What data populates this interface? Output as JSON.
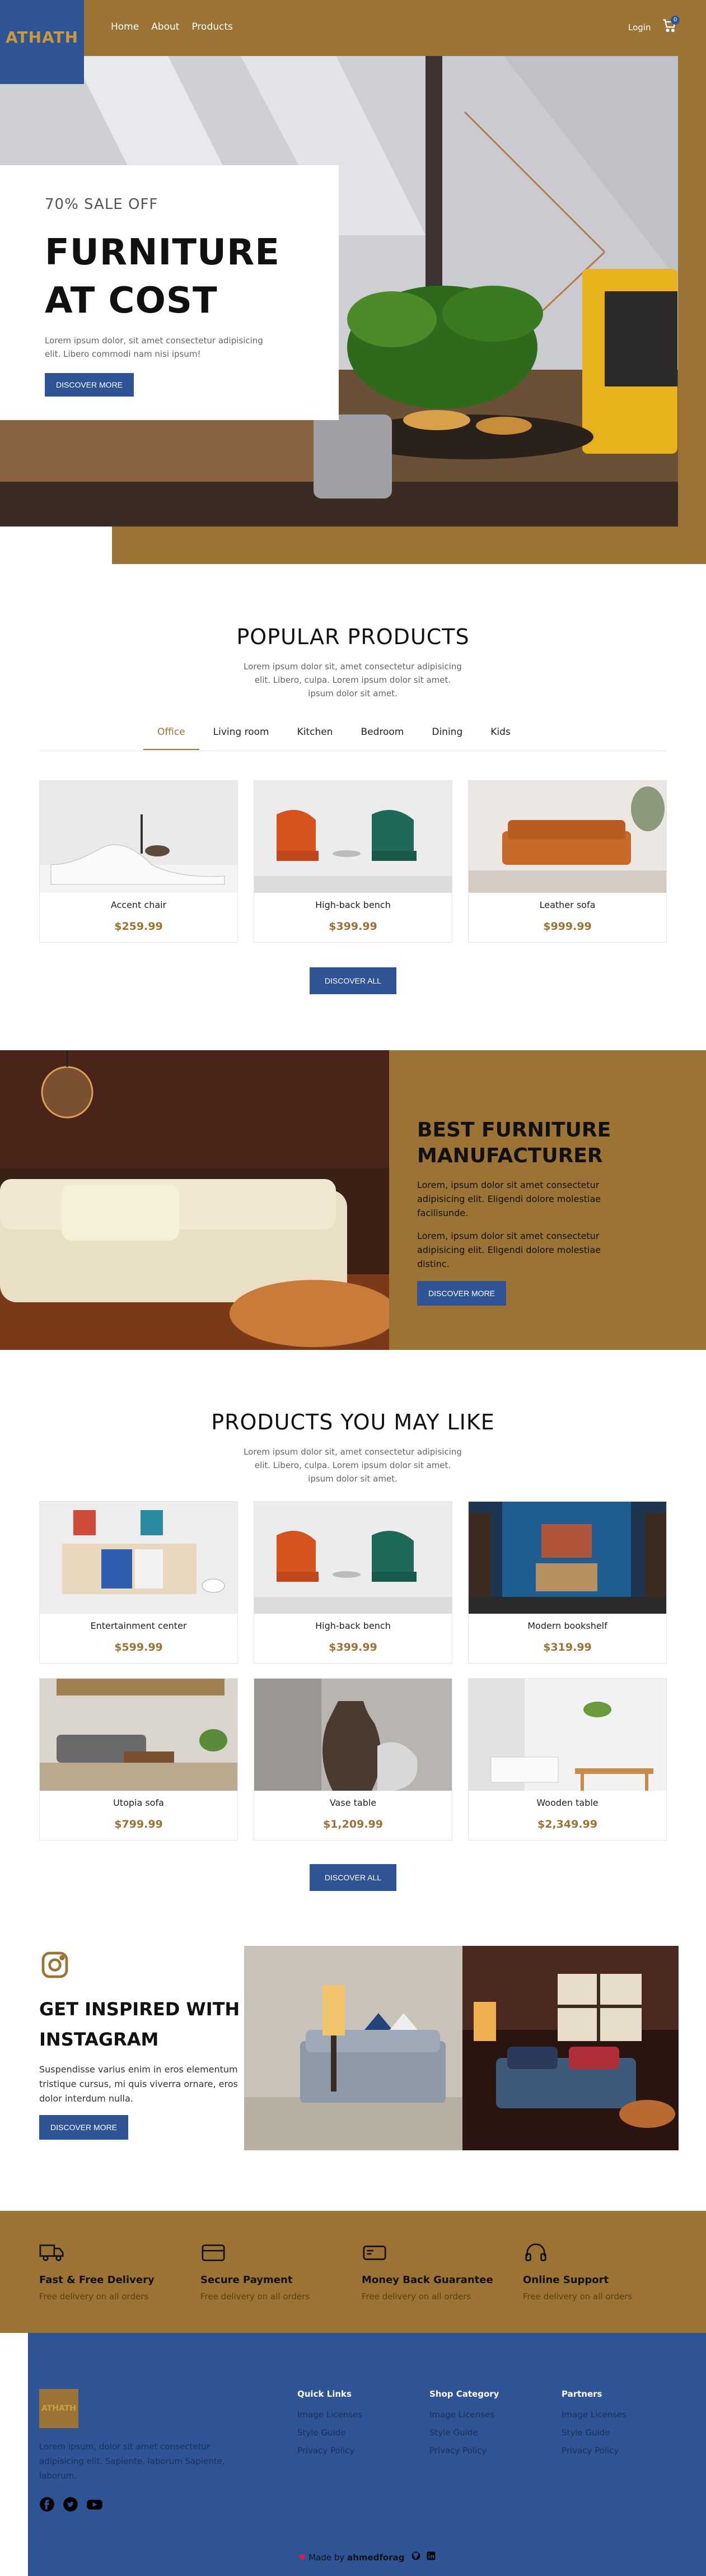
{
  "header": {
    "logo": "ATHATH",
    "nav": [
      "Home",
      "About",
      "Products"
    ],
    "login": "Login",
    "cart_count": "0"
  },
  "hero": {
    "sale": "70% SALE OFF",
    "title_line1": "FURNITURE",
    "title_line2": "AT COST",
    "text": "Lorem ipsum dolor, sit amet consectetur adipisicing elit. Libero commodi nam nisi ipsum!",
    "button": "DISCOVER MORE"
  },
  "popular": {
    "title": "POPULAR PRODUCTS",
    "subtitle": "Lorem ipsum dolor sit, amet consectetur adipisicing elit. Libero, culpa. Lorem ipsum dolor sit amet. ipsum dolor sit amet.",
    "tabs": [
      "Office",
      "Living room",
      "Kitchen",
      "Bedroom",
      "Dining",
      "Kids"
    ],
    "products": [
      {
        "name": "Accent chair",
        "price": "$259.99"
      },
      {
        "name": "High-back bench",
        "price": "$399.99"
      },
      {
        "name": "Leather sofa",
        "price": "$999.99"
      }
    ],
    "button": "DISCOVER ALL"
  },
  "manufacturer": {
    "title_line1": "BEST FURNITURE",
    "title_line2": "MANUFACTURER",
    "p1": "Lorem, ipsum dolor sit amet consectetur adipisicing elit. Eligendi dolore molestiae facilisunde.",
    "p2": "Lorem, ipsum dolor sit amet consectetur adipisicing elit. Eligendi dolore molestiae distinc.",
    "button": "DISCOVER MORE"
  },
  "like": {
    "title": "PRODUCTS YOU MAY LIKE",
    "subtitle": "Lorem ipsum dolor sit, amet consectetur adipisicing elit. Libero, culpa. Lorem ipsum dolor sit amet. ipsum dolor sit amet.",
    "products": [
      {
        "name": "Entertainment center",
        "price": "$599.99"
      },
      {
        "name": "High-back bench",
        "price": "$399.99"
      },
      {
        "name": "Modern bookshelf",
        "price": "$319.99"
      },
      {
        "name": "Utopia sofa",
        "price": "$799.99"
      },
      {
        "name": "Vase table",
        "price": "$1,209.99"
      },
      {
        "name": "Wooden table",
        "price": "$2,349.99"
      }
    ],
    "button": "DISCOVER ALL"
  },
  "instagram": {
    "title_line1": "GET INSPIRED WITH",
    "title_line2": "INSTAGRAM",
    "text": "Suspendisse varius enim in eros elementum tristique cursus, mi quis viverra ornare, eros dolor interdum nulla.",
    "button": "DISCOVER MORE"
  },
  "features": [
    {
      "title": "Fast & Free Delivery",
      "sub": "Free delivery on all orders",
      "icon": "truck-icon"
    },
    {
      "title": "Secure Payment",
      "sub": "Free delivery on all orders",
      "icon": "credit-card-icon"
    },
    {
      "title": "Money Back Guarantee",
      "sub": "Free delivery on all orders",
      "icon": "money-icon"
    },
    {
      "title": "Online Support",
      "sub": "Free delivery on all orders",
      "icon": "headset-icon"
    }
  ],
  "footer": {
    "logo": "ATHATH",
    "about": "Lorem ipsum, dolor sit amet consectetur adipisicing elit. Sapiente, laborum Sapiente, laborum.",
    "columns": [
      {
        "title": "Quick Links",
        "links": [
          "Image Licenses",
          "Style Guide",
          "Privacy Policy"
        ]
      },
      {
        "title": "Shop Category",
        "links": [
          "Image Licenses",
          "Style Guide",
          "Privacy Policy"
        ]
      },
      {
        "title": "Partners",
        "links": [
          "Image Licenses",
          "Style Guide",
          "Privacy Policy"
        ]
      }
    ],
    "made_by_prefix": "Made by",
    "made_by_name": "ahmedforag"
  },
  "colors": {
    "brown": "#9b7334",
    "blue": "#2f5496"
  }
}
